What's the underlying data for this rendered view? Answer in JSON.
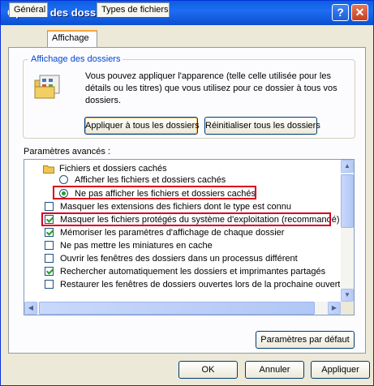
{
  "window": {
    "title": "Options des dossiers",
    "help_glyph": "?",
    "close_glyph": "✕"
  },
  "tabs": [
    {
      "label": "Général",
      "active": false
    },
    {
      "label": "Affichage",
      "active": true
    },
    {
      "label": "Types de fichiers",
      "active": false
    }
  ],
  "folder_view": {
    "group_title": "Affichage des dossiers",
    "description": "Vous pouvez appliquer l'apparence (telle celle utilisée pour les détails ou les titres) que vous utilisez pour ce dossier à tous vos dossiers.",
    "apply_all_label": "Appliquer à tous les dossiers",
    "reset_all_label": "Réinitialiser tous les dossiers"
  },
  "advanced": {
    "label": "Paramètres avancés :",
    "items": [
      {
        "kind": "folder",
        "label": "Fichiers et dossiers cachés"
      },
      {
        "kind": "radio",
        "checked": false,
        "label": "Afficher les fichiers et dossiers cachés"
      },
      {
        "kind": "radio",
        "checked": true,
        "label": "Ne pas afficher les fichiers et dossiers cachés",
        "highlighted": true
      },
      {
        "kind": "checkbox",
        "checked": false,
        "label": "Masquer les extensions des fichiers dont le type est connu"
      },
      {
        "kind": "checkbox",
        "checked": true,
        "label": "Masquer les fichiers protégés du système d'exploitation (recommandé)",
        "highlighted": true
      },
      {
        "kind": "checkbox",
        "checked": true,
        "label": "Mémoriser les paramètres d'affichage de chaque dossier"
      },
      {
        "kind": "checkbox",
        "checked": false,
        "label": "Ne pas mettre les miniatures en cache"
      },
      {
        "kind": "checkbox",
        "checked": false,
        "label": "Ouvrir les fenêtres des dossiers dans un processus différent"
      },
      {
        "kind": "checkbox",
        "checked": true,
        "label": "Rechercher automatiquement les dossiers et imprimantes partagés"
      },
      {
        "kind": "checkbox",
        "checked": false,
        "label": "Restaurer les fenêtres de dossiers ouvertes lors de la prochaine ouverture"
      }
    ],
    "defaults_label": "Paramètres par défaut"
  },
  "footer": {
    "ok_label": "OK",
    "cancel_label": "Annuler",
    "apply_label": "Appliquer"
  },
  "colors": {
    "titlebar": "#0a5fe0",
    "highlight_box": "#d8001b",
    "check_mark": "#21a121",
    "group_title": "#0046d5"
  },
  "icons": [
    "help-icon",
    "close-icon",
    "folder-options-icon",
    "folder-icon",
    "scroll-up-icon",
    "scroll-down-icon",
    "scroll-left-icon",
    "scroll-right-icon"
  ]
}
